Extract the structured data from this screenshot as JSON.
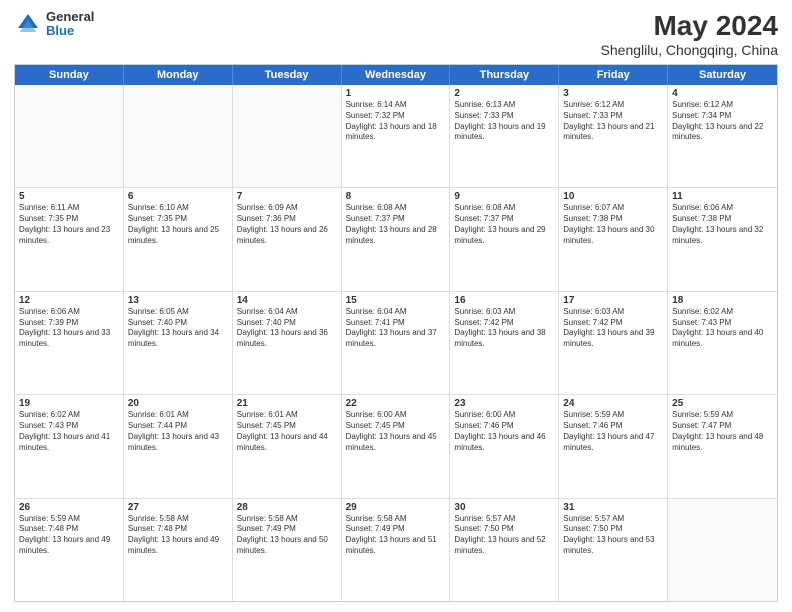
{
  "header": {
    "logo": {
      "general": "General",
      "blue": "Blue"
    },
    "title": "May 2024",
    "location": "Shenglilu, Chongqing, China"
  },
  "days_of_week": [
    "Sunday",
    "Monday",
    "Tuesday",
    "Wednesday",
    "Thursday",
    "Friday",
    "Saturday"
  ],
  "weeks": [
    [
      {
        "day": "",
        "empty": true
      },
      {
        "day": "",
        "empty": true
      },
      {
        "day": "",
        "empty": true
      },
      {
        "day": "1",
        "sunrise": "6:14 AM",
        "sunset": "7:32 PM",
        "daylight": "13 hours and 18 minutes."
      },
      {
        "day": "2",
        "sunrise": "6:13 AM",
        "sunset": "7:33 PM",
        "daylight": "13 hours and 19 minutes."
      },
      {
        "day": "3",
        "sunrise": "6:12 AM",
        "sunset": "7:33 PM",
        "daylight": "13 hours and 21 minutes."
      },
      {
        "day": "4",
        "sunrise": "6:12 AM",
        "sunset": "7:34 PM",
        "daylight": "13 hours and 22 minutes."
      }
    ],
    [
      {
        "day": "5",
        "sunrise": "6:11 AM",
        "sunset": "7:35 PM",
        "daylight": "13 hours and 23 minutes."
      },
      {
        "day": "6",
        "sunrise": "6:10 AM",
        "sunset": "7:35 PM",
        "daylight": "13 hours and 25 minutes."
      },
      {
        "day": "7",
        "sunrise": "6:09 AM",
        "sunset": "7:36 PM",
        "daylight": "13 hours and 26 minutes."
      },
      {
        "day": "8",
        "sunrise": "6:08 AM",
        "sunset": "7:37 PM",
        "daylight": "13 hours and 28 minutes."
      },
      {
        "day": "9",
        "sunrise": "6:08 AM",
        "sunset": "7:37 PM",
        "daylight": "13 hours and 29 minutes."
      },
      {
        "day": "10",
        "sunrise": "6:07 AM",
        "sunset": "7:38 PM",
        "daylight": "13 hours and 30 minutes."
      },
      {
        "day": "11",
        "sunrise": "6:06 AM",
        "sunset": "7:38 PM",
        "daylight": "13 hours and 32 minutes."
      }
    ],
    [
      {
        "day": "12",
        "sunrise": "6:06 AM",
        "sunset": "7:39 PM",
        "daylight": "13 hours and 33 minutes."
      },
      {
        "day": "13",
        "sunrise": "6:05 AM",
        "sunset": "7:40 PM",
        "daylight": "13 hours and 34 minutes."
      },
      {
        "day": "14",
        "sunrise": "6:04 AM",
        "sunset": "7:40 PM",
        "daylight": "13 hours and 36 minutes."
      },
      {
        "day": "15",
        "sunrise": "6:04 AM",
        "sunset": "7:41 PM",
        "daylight": "13 hours and 37 minutes."
      },
      {
        "day": "16",
        "sunrise": "6:03 AM",
        "sunset": "7:42 PM",
        "daylight": "13 hours and 38 minutes."
      },
      {
        "day": "17",
        "sunrise": "6:03 AM",
        "sunset": "7:42 PM",
        "daylight": "13 hours and 39 minutes."
      },
      {
        "day": "18",
        "sunrise": "6:02 AM",
        "sunset": "7:43 PM",
        "daylight": "13 hours and 40 minutes."
      }
    ],
    [
      {
        "day": "19",
        "sunrise": "6:02 AM",
        "sunset": "7:43 PM",
        "daylight": "13 hours and 41 minutes."
      },
      {
        "day": "20",
        "sunrise": "6:01 AM",
        "sunset": "7:44 PM",
        "daylight": "13 hours and 43 minutes."
      },
      {
        "day": "21",
        "sunrise": "6:01 AM",
        "sunset": "7:45 PM",
        "daylight": "13 hours and 44 minutes."
      },
      {
        "day": "22",
        "sunrise": "6:00 AM",
        "sunset": "7:45 PM",
        "daylight": "13 hours and 45 minutes."
      },
      {
        "day": "23",
        "sunrise": "6:00 AM",
        "sunset": "7:46 PM",
        "daylight": "13 hours and 46 minutes."
      },
      {
        "day": "24",
        "sunrise": "5:59 AM",
        "sunset": "7:46 PM",
        "daylight": "13 hours and 47 minutes."
      },
      {
        "day": "25",
        "sunrise": "5:59 AM",
        "sunset": "7:47 PM",
        "daylight": "13 hours and 48 minutes."
      }
    ],
    [
      {
        "day": "26",
        "sunrise": "5:59 AM",
        "sunset": "7:48 PM",
        "daylight": "13 hours and 49 minutes."
      },
      {
        "day": "27",
        "sunrise": "5:58 AM",
        "sunset": "7:48 PM",
        "daylight": "13 hours and 49 minutes."
      },
      {
        "day": "28",
        "sunrise": "5:58 AM",
        "sunset": "7:49 PM",
        "daylight": "13 hours and 50 minutes."
      },
      {
        "day": "29",
        "sunrise": "5:58 AM",
        "sunset": "7:49 PM",
        "daylight": "13 hours and 51 minutes."
      },
      {
        "day": "30",
        "sunrise": "5:57 AM",
        "sunset": "7:50 PM",
        "daylight": "13 hours and 52 minutes."
      },
      {
        "day": "31",
        "sunrise": "5:57 AM",
        "sunset": "7:50 PM",
        "daylight": "13 hours and 53 minutes."
      },
      {
        "day": "",
        "empty": true
      }
    ]
  ],
  "labels": {
    "sunrise_prefix": "Sunrise: ",
    "sunset_prefix": "Sunset: ",
    "daylight_prefix": "Daylight: "
  }
}
